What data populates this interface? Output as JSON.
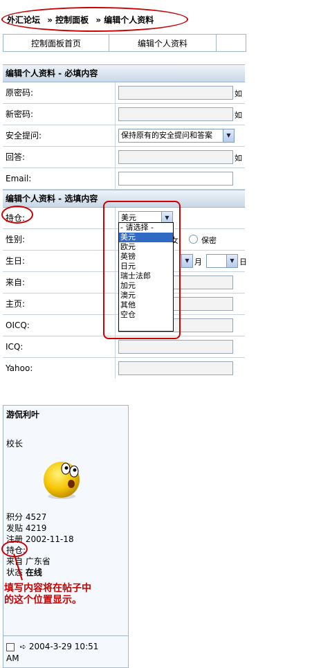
{
  "breadcrumb": [
    "外汇论坛",
    "» 控制面板",
    "» 编辑个人资料"
  ],
  "tabs": [
    "控制面板首页",
    "编辑个人资料"
  ],
  "form": {
    "required_header": "编辑个人资料 - 必填内容",
    "optional_header": "编辑个人资料 - 选填内容",
    "rows_required": [
      {
        "label": "原密码:",
        "tail": "如"
      },
      {
        "label": "新密码:",
        "tail": "如"
      },
      {
        "label": "安全提问:",
        "select": "保持原有的安全提问和答案"
      },
      {
        "label": "回答:",
        "tail": "如"
      },
      {
        "label": "Email:"
      }
    ],
    "rows_optional": [
      {
        "label": "持仓:",
        "select": "美元"
      },
      {
        "label": "性别:",
        "radio": "保密",
        "radio_prefix": "女"
      },
      {
        "label": "生日:",
        "month": "月",
        "day": "日"
      },
      {
        "label": "来自:"
      },
      {
        "label": "主页:"
      },
      {
        "label": "OICQ:"
      },
      {
        "label": "ICQ:"
      },
      {
        "label": "Yahoo:"
      }
    ],
    "dropdown_options": [
      "- 请选择 -",
      "美元",
      "欧元",
      "英镑",
      "日元",
      "瑞士法郎",
      "加元",
      "澳元",
      "其他",
      "空仓"
    ],
    "dropdown_selected": "美元"
  },
  "post": {
    "username": "游侃利叶",
    "rank": "校长",
    "stats": [
      {
        "k": "积分",
        "v": "4527"
      },
      {
        "k": "发贴",
        "v": "4219"
      },
      {
        "k": "注册",
        "v": "2002-11-18"
      },
      {
        "k": "持仓:",
        "v": ""
      },
      {
        "k": "来自",
        "v": "广东省"
      },
      {
        "k": "状态",
        "v": "在线"
      }
    ],
    "date": "2004-3-29 10:51",
    "ampm": "AM"
  },
  "annotation": [
    "填写内容将在帖子中",
    "的这个位置显示。"
  ],
  "colors": {
    "accent": "#cc0000",
    "header_bg": "#c9d7e6",
    "highlight": "#316ac5"
  }
}
